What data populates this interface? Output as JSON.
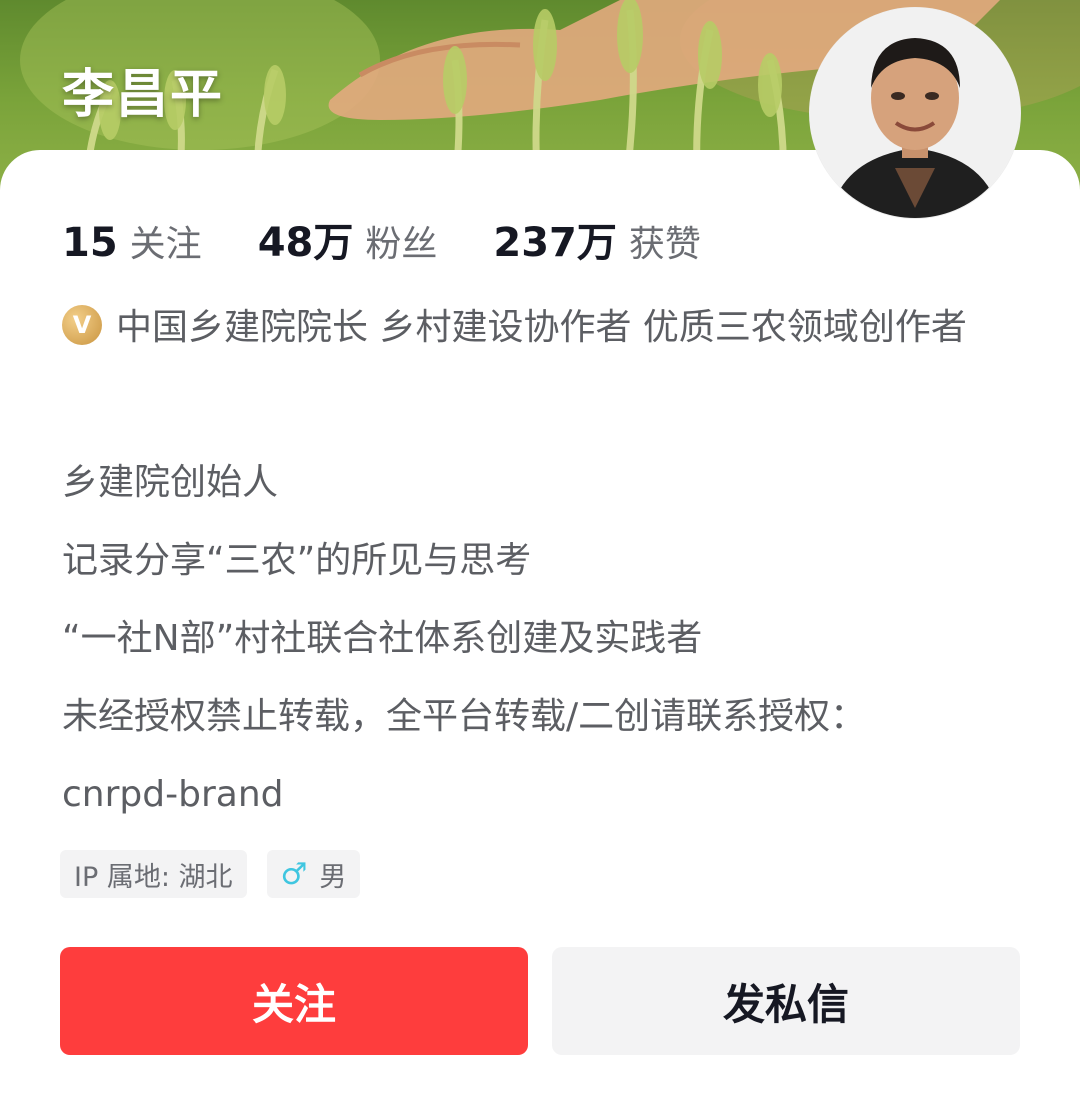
{
  "profile": {
    "name": "李昌平",
    "avatar_icon": "person-portrait-icon",
    "banner_icon": "wheat-field-hand-icon"
  },
  "stats": [
    {
      "num": "15",
      "label": "关注"
    },
    {
      "num": "48万",
      "label": "粉丝"
    },
    {
      "num": "237万",
      "label": "获赞"
    }
  ],
  "verification": {
    "badge_icon": "verified-v-badge-icon",
    "badge_glyph": "V",
    "text": "中国乡建院院长 乡村建设协作者 优质三农领域创作者"
  },
  "bio": [
    "乡建院创始人",
    "记录分享“三农”的所见与思考",
    "“一社N部”村社联合社体系创建及实践者",
    "未经授权禁止转载，全平台转载/二创请联系授权：",
    "cnrpd-brand"
  ],
  "tags": {
    "ip": "IP 属地: 湖北",
    "gender_icon": "male-symbol-icon",
    "gender_glyph": "♂",
    "gender": "男"
  },
  "actions": {
    "follow": "关注",
    "message": "发私信"
  },
  "colors": {
    "follow_button": "#fe3d3d",
    "message_button": "#f3f3f4",
    "gender_icon": "#3fc6e0",
    "verify_badge": "#d4a45a"
  }
}
